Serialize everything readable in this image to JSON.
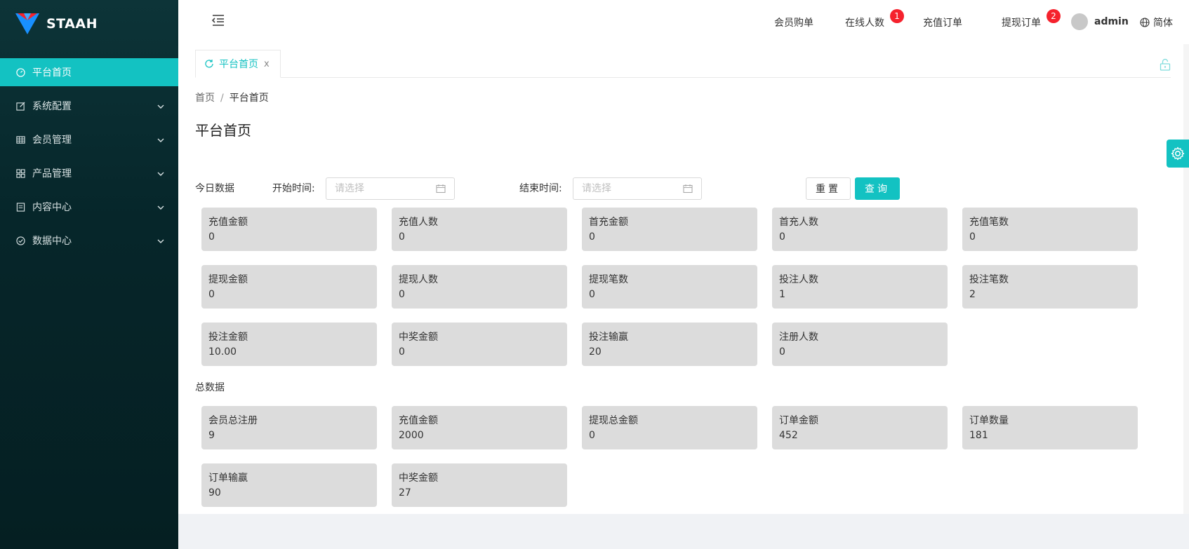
{
  "brand": {
    "name": "STAAH"
  },
  "sidebar": {
    "items": [
      {
        "label": "平台首页",
        "icon": "dashboard-icon",
        "active": true
      },
      {
        "label": "系统配置",
        "icon": "edit-icon"
      },
      {
        "label": "会员管理",
        "icon": "table-icon"
      },
      {
        "label": "产品管理",
        "icon": "grid-icon"
      },
      {
        "label": "内容中心",
        "icon": "document-icon"
      },
      {
        "label": "数据中心",
        "icon": "check-circle-icon"
      }
    ]
  },
  "header": {
    "nav": [
      {
        "label": "会员购单"
      },
      {
        "label": "在线人数",
        "badge": "1"
      },
      {
        "label": "充值订单"
      },
      {
        "label": "提现订单",
        "badge": "2"
      }
    ],
    "username": "admin",
    "language": "简体"
  },
  "tabs": [
    {
      "label": "平台首页",
      "close": "x"
    }
  ],
  "breadcrumb": {
    "home": "首页",
    "separator": "/",
    "current": "平台首页"
  },
  "page_title": "平台首页",
  "filter": {
    "section_label": "今日数据",
    "start_label": "开始时间:",
    "end_label": "结束时间:",
    "start_placeholder": "请选择",
    "end_placeholder": "请选择",
    "reset_label": "重置",
    "query_label": "查询"
  },
  "today_cards": [
    {
      "label": "充值金额",
      "value": "0"
    },
    {
      "label": "充值人数",
      "value": "0"
    },
    {
      "label": "首充金额",
      "value": "0"
    },
    {
      "label": "首充人数",
      "value": "0"
    },
    {
      "label": "充值笔数",
      "value": "0"
    },
    {
      "label": "提现金额",
      "value": "0"
    },
    {
      "label": "提现人数",
      "value": "0"
    },
    {
      "label": "提现笔数",
      "value": "0"
    },
    {
      "label": "投注人数",
      "value": "1"
    },
    {
      "label": "投注笔数",
      "value": "2"
    },
    {
      "label": "投注金额",
      "value": "10.00"
    },
    {
      "label": "中奖金额",
      "value": "0"
    },
    {
      "label": "投注输赢",
      "value": "20"
    },
    {
      "label": "注册人数",
      "value": "0"
    }
  ],
  "total_section_label": "总数据",
  "total_cards": [
    {
      "label": "会员总注册",
      "value": "9"
    },
    {
      "label": "充值金额",
      "value": "2000"
    },
    {
      "label": "提现总金额",
      "value": "0"
    },
    {
      "label": "订单金额",
      "value": "452"
    },
    {
      "label": "订单数量",
      "value": "181"
    },
    {
      "label": "订单输赢",
      "value": "90"
    },
    {
      "label": "中奖金额",
      "value": "27"
    }
  ],
  "colors": {
    "accent": "#13c2c2",
    "sidebar": "#06262a",
    "badge": "#f5222d",
    "card": "#dcdcdc"
  }
}
